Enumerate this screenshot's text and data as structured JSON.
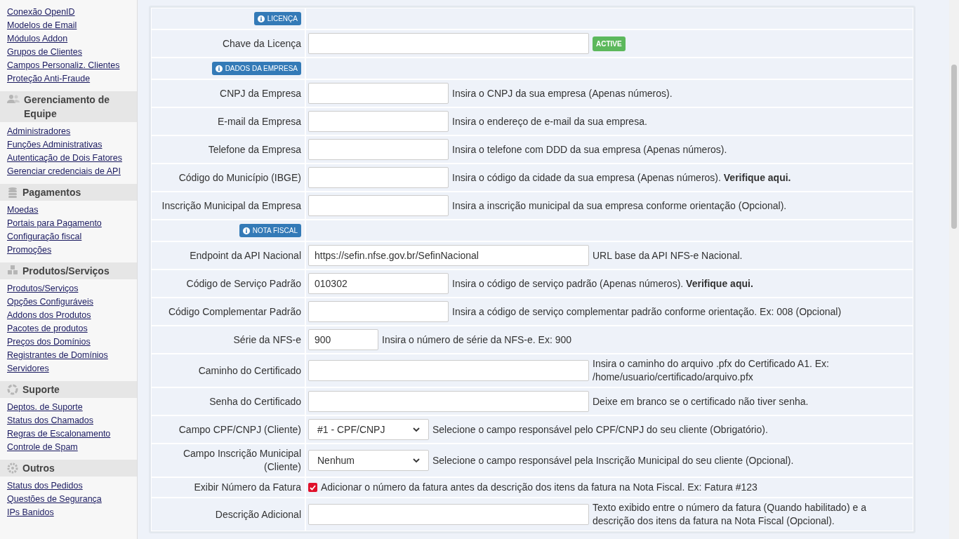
{
  "sidebar": [
    {
      "links": [
        "Conexão OpenID",
        "Modelos de Email",
        "Módulos Addon",
        "Grupos de Clientes",
        "Campos Personaliz. Clientes",
        "Proteção Anti-Fraude"
      ]
    },
    {
      "title": "Gerenciamento de Equipe",
      "links": [
        "Administradores",
        "Funções Administrativas",
        "Autenticação de Dois Fatores",
        "Gerenciar credenciais de API"
      ]
    },
    {
      "title": "Pagamentos",
      "links": [
        "Moedas",
        "Portais para Pagamento",
        "Configuração fiscal",
        "Promoções"
      ]
    },
    {
      "title": "Produtos/Serviços",
      "links": [
        "Produtos/Serviços",
        "Opções Configuráveis",
        "Addons dos Produtos",
        "Pacotes de produtos",
        "Preços dos Domínios",
        "Registrantes de Domínios",
        "Servidores"
      ]
    },
    {
      "title": "Suporte",
      "links": [
        "Deptos. de Suporte",
        "Status dos Chamados",
        "Regras de Escalonamento",
        "Controle de Spam"
      ]
    },
    {
      "title": "Outros",
      "links": [
        "Status dos Pedidos",
        "Questões de Segurança",
        "IPs Banidos"
      ]
    }
  ],
  "form": [
    {
      "kind": "section",
      "badge": "LICENÇA"
    },
    {
      "kind": "wide",
      "label": "Chave da Licença",
      "status": "ACTIVE"
    },
    {
      "kind": "section",
      "badge": "DADOS DA EMPRESA"
    },
    {
      "kind": "medium",
      "label": "CNPJ da Empresa",
      "help": "Insira o CNPJ da sua empresa (Apenas números)."
    },
    {
      "kind": "medium",
      "label": "E-mail da Empresa",
      "help": "Insira o endereço de e-mail da sua empresa."
    },
    {
      "kind": "medium",
      "label": "Telefone da Empresa",
      "help": "Insira o telefone com DDD da sua empresa (Apenas números)."
    },
    {
      "kind": "medium",
      "label": "Código do Município (IBGE)",
      "help": "Insira o código da cidade da sua empresa (Apenas números). **Verifique aqui.**"
    },
    {
      "kind": "medium",
      "label": "Inscrição Municipal da Empresa",
      "help": "Insira a inscrição municipal da sua empresa conforme orientação (Opcional)."
    },
    {
      "kind": "section",
      "badge": "NOTA FISCAL"
    },
    {
      "kind": "wide",
      "label": "Endpoint da API Nacional",
      "value": "https://sefin.nfse.gov.br/SefinNacional",
      "help": "URL base da API NFS-e Nacional."
    },
    {
      "kind": "medium",
      "label": "Código de Serviço Padrão",
      "value": "010302",
      "help": "Insira o código de serviço padrão (Apenas números). **Verifique aqui.**"
    },
    {
      "kind": "medium",
      "label": "Código Complementar Padrão",
      "help": "Insira a código de serviço complementar padrão conforme orientação. Ex: 008 (Opcional)"
    },
    {
      "kind": "small",
      "label": "Série da NFS-e",
      "value": "900",
      "help": "Insira o número de série da NFS-e. Ex: 900"
    },
    {
      "kind": "wide",
      "label": "Caminho do Certificado",
      "help": "Insira o caminho do arquivo .pfx do Certificado A1. Ex: /home/usuario/certificado/arquivo.pfx"
    },
    {
      "kind": "wide",
      "label": "Senha do Certificado",
      "help": "Deixe em branco se o certificado não tiver senha."
    },
    {
      "kind": "select",
      "label": "Campo CPF/CNPJ (Cliente)",
      "value": "#1 - CPF/CNPJ",
      "help": "Selecione o campo responsável pelo CPF/CNPJ do seu cliente (Obrigatório)."
    },
    {
      "kind": "select",
      "label": "Campo Inscrição Municipal (Cliente)",
      "value": "Nenhum",
      "help": "Selecione o campo responsável pela Inscrição Municipal do seu cliente (Opcional)."
    },
    {
      "kind": "checkbox",
      "label": "Exibir Número da Fatura",
      "checked": true,
      "help": "Adicionar o número da fatura antes da descrição dos itens da fatura na Nota Fiscal. Ex: Fatura #123"
    },
    {
      "kind": "wide",
      "label": "Descrição Adicional",
      "help": "Texto exibido entre o número da fatura (Quando habilitado) e a descrição dos itens da fatura na Nota Fiscal (Opcional)."
    }
  ]
}
